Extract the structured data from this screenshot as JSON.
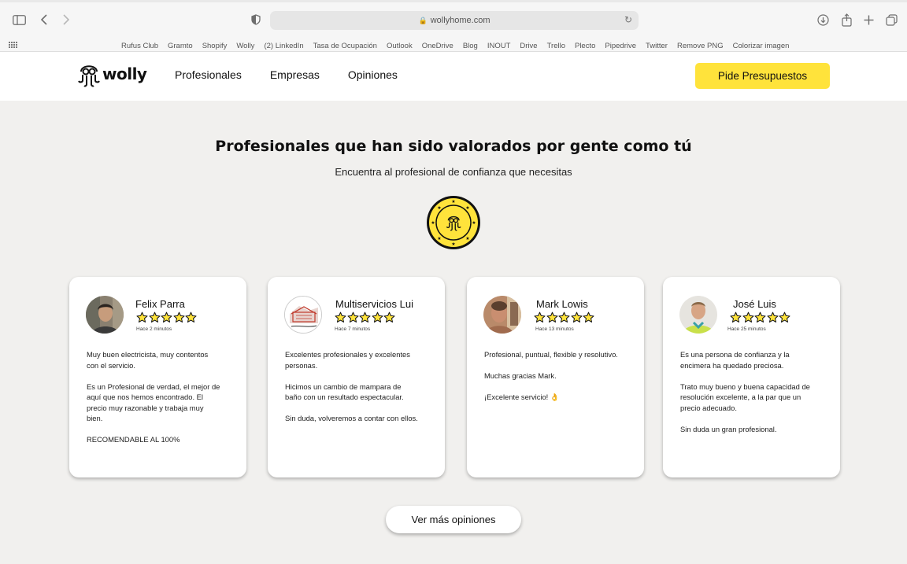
{
  "browser": {
    "url": "wollyhome.com",
    "bookmarks": [
      "Rufus Club",
      "Gramto",
      "Shopify",
      "Wolly",
      "(2) LinkedIn",
      "Tasa de Ocupación",
      "Outlook",
      "OneDrive",
      "Blog",
      "INOUT",
      "Drive",
      "Trello",
      "Plecto",
      "Pipedrive",
      "Twitter",
      "Remove PNG",
      "Colorizar imagen"
    ]
  },
  "header": {
    "logo_text": "wolly",
    "nav": [
      "Profesionales",
      "Empresas",
      "Opiniones"
    ],
    "cta_label": "Pide Presupuestos"
  },
  "main": {
    "title": "Profesionales que han sido valorados por gente como tú",
    "subtitle": "Encuentra al profesional de confianza que necesitas",
    "more_button": "Ver más opiniones"
  },
  "reviews": [
    {
      "name": "Felix Parra",
      "rating": 5,
      "time": "Hace 2 minutos",
      "paragraphs": [
        "Muy buen electricista, muy contentos con el servicio.",
        "Es un Profesional de verdad, el mejor de aquí que nos hemos encontrado. El precio muy razonable y trabaja muy bien.",
        "RECOMENDABLE AL 100%"
      ]
    },
    {
      "name": "Multiservicios Lui",
      "rating": 5,
      "time": "Hace 7 minutos",
      "paragraphs": [
        "Excelentes profesionales y excelentes personas.",
        "Hicimos un cambio de mampara de baño con un resultado espectacular.",
        "Sin duda, volveremos a contar con ellos."
      ]
    },
    {
      "name": "Mark Lowis",
      "rating": 5,
      "time": "Hace 13 minutos",
      "paragraphs": [
        "Profesional, puntual, flexible y resolutivo.",
        "Muchas gracias Mark.",
        "¡Excelente servicio! 👌"
      ]
    },
    {
      "name": "José Luis",
      "rating": 5,
      "time": "Hace 25 minutos",
      "paragraphs": [
        "Es una persona de confianza y la encimera ha quedado preciosa.",
        "Trato muy bueno y buena capacidad de resolución excelente, a la par que un precio adecuado.",
        "Sin duda un gran profesional."
      ]
    }
  ],
  "colors": {
    "accent": "#ffe33b",
    "page_bg": "#f1f0ee",
    "star_fill": "#ffe33b"
  }
}
